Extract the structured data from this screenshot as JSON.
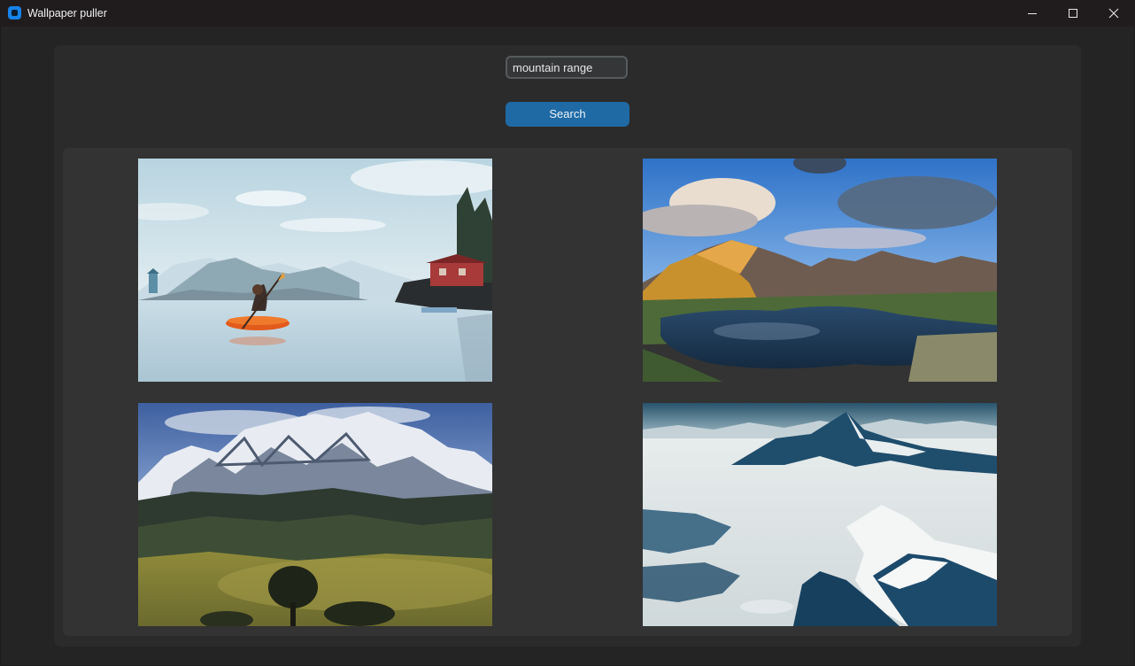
{
  "window": {
    "title": "Wallpaper puller",
    "controls": [
      "minimize-icon",
      "maximize-icon",
      "close-icon"
    ]
  },
  "search": {
    "value": "mountain range",
    "button_label": "Search"
  },
  "results": [
    {
      "icon": "image",
      "subject": "illustrated kayaker on lake with red cabin"
    },
    {
      "icon": "image",
      "subject": "alpine lake below rocky peaks at sunset"
    },
    {
      "icon": "image",
      "subject": "snowy mountain ridge above green hills"
    },
    {
      "icon": "image",
      "subject": "aerial view of snowy glacier mountains"
    }
  ],
  "colors": {
    "titlebar": "#201c1e",
    "background": "#242424",
    "panel": "#2b2b2b",
    "results_frame": "#333333",
    "accent": "#1f6aa5"
  }
}
